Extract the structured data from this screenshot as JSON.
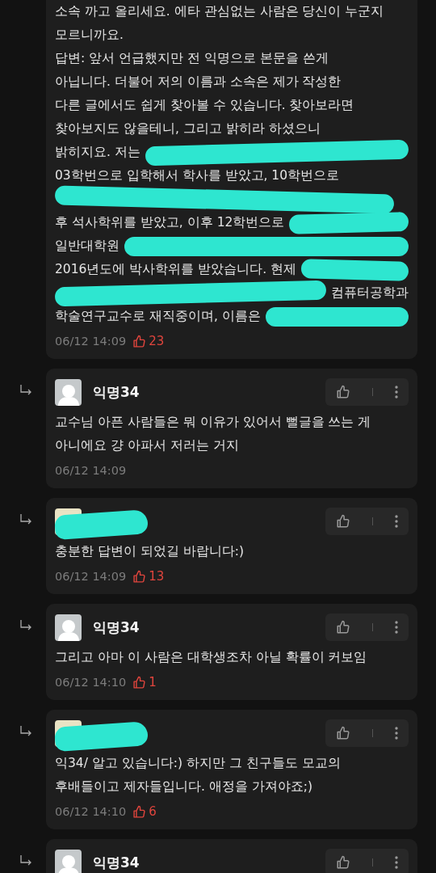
{
  "comments": [
    {
      "is_reply": false,
      "lines": [
        [
          {
            "kind": "text",
            "text": "소속 까고 올리세요. 에타 관심없는 사람은 당신이 누군지"
          }
        ],
        [
          {
            "kind": "text",
            "text": "모르니까요."
          }
        ],
        [
          {
            "kind": "text",
            "text": "답변: 앞서 언급했지만 전 익명으로 본문을 쓴게"
          }
        ],
        [
          {
            "kind": "text",
            "text": "아닙니다. 더불어 저의 이름과 소속은 제가 작성한"
          }
        ],
        [
          {
            "kind": "text",
            "text": "다른 글에서도 쉽게 찾아볼 수 있습니다. 찾아보라면"
          }
        ],
        [
          {
            "kind": "text",
            "text": "찾아보지도 않을테니, 그리고 밝히라 하셨으니"
          }
        ],
        [
          {
            "kind": "text",
            "text": "밝히지요. 저는"
          },
          {
            "kind": "redacted"
          }
        ],
        [
          {
            "kind": "text",
            "text": "03학번으로 입학해서 학사를 받았고, 10학번으로"
          }
        ],
        [
          {
            "kind": "redacted"
          }
        ],
        [
          {
            "kind": "text",
            "text": "후 석사학위를 받았고, 이후 12학번으로"
          },
          {
            "kind": "redacted"
          }
        ],
        [
          {
            "kind": "text",
            "text": "일반대학원"
          },
          {
            "kind": "redacted"
          }
        ],
        [
          {
            "kind": "text",
            "text": "2016년도에 박사학위를 받았습니다. 현제"
          },
          {
            "kind": "redacted"
          }
        ],
        [
          {
            "kind": "redacted"
          },
          {
            "kind": "text",
            "text": "컴퓨터공학과"
          }
        ],
        [
          {
            "kind": "text",
            "text": "학술연구교수로 재직중이며, 이름은"
          },
          {
            "kind": "redacted"
          }
        ]
      ],
      "time": "06/12 14:09",
      "likes": "23"
    },
    {
      "is_reply": true,
      "author": {
        "kind": "name",
        "name": "익명34"
      },
      "lines": [
        [
          {
            "kind": "text",
            "text": "교수님 아픈 사람들은 뭐 이유가 있어서 뻘글을 쓰는 게"
          }
        ],
        [
          {
            "kind": "text",
            "text": "아니에요 걍 아파서 저러는 거지"
          }
        ]
      ],
      "time": "06/12 14:09"
    },
    {
      "is_reply": true,
      "author": {
        "kind": "redacted"
      },
      "lines": [
        [
          {
            "kind": "text",
            "text": "충분한 답변이 되었길 바랍니다:)"
          }
        ]
      ],
      "time": "06/12 14:09",
      "likes": "13"
    },
    {
      "is_reply": true,
      "author": {
        "kind": "name",
        "name": "익명34"
      },
      "lines": [
        [
          {
            "kind": "text",
            "text": "그리고 아마 이 사람은 대학생조차 아닐 확률이 커보임"
          }
        ]
      ],
      "time": "06/12 14:10",
      "likes": "1"
    },
    {
      "is_reply": true,
      "author": {
        "kind": "redacted"
      },
      "lines": [
        [
          {
            "kind": "text",
            "text": "익34/ 알고 있습니다:) 하지만 그 친구들도 모교의"
          }
        ],
        [
          {
            "kind": "text",
            "text": "후배들이고 제자들입니다. 애정을 가져야죠;)"
          }
        ]
      ],
      "time": "06/12 14:10",
      "likes": "6"
    },
    {
      "is_reply": true,
      "author": {
        "kind": "name",
        "name": "익명34"
      }
    }
  ]
}
